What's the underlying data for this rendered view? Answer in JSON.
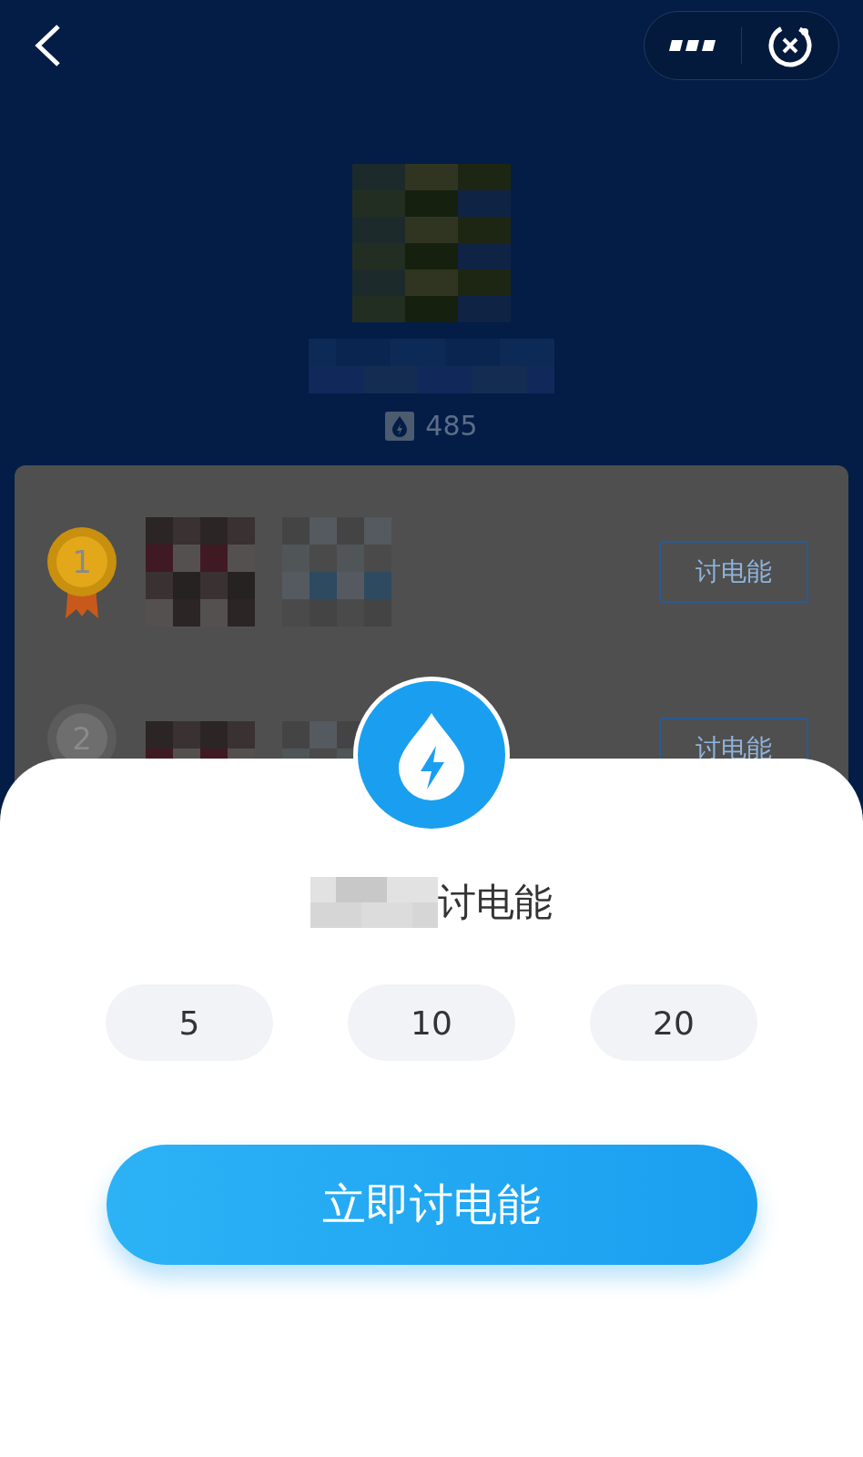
{
  "profile": {
    "balance": "485"
  },
  "ranking": [
    {
      "rank": "1",
      "kind": "gold",
      "action": "讨电能"
    },
    {
      "rank": "2",
      "kind": "silver",
      "action": "讨电能"
    }
  ],
  "sheet": {
    "title": "讨电能",
    "amounts": [
      {
        "label": "5"
      },
      {
        "label": "10"
      },
      {
        "label": "20"
      }
    ],
    "submit": "立即讨电能"
  }
}
